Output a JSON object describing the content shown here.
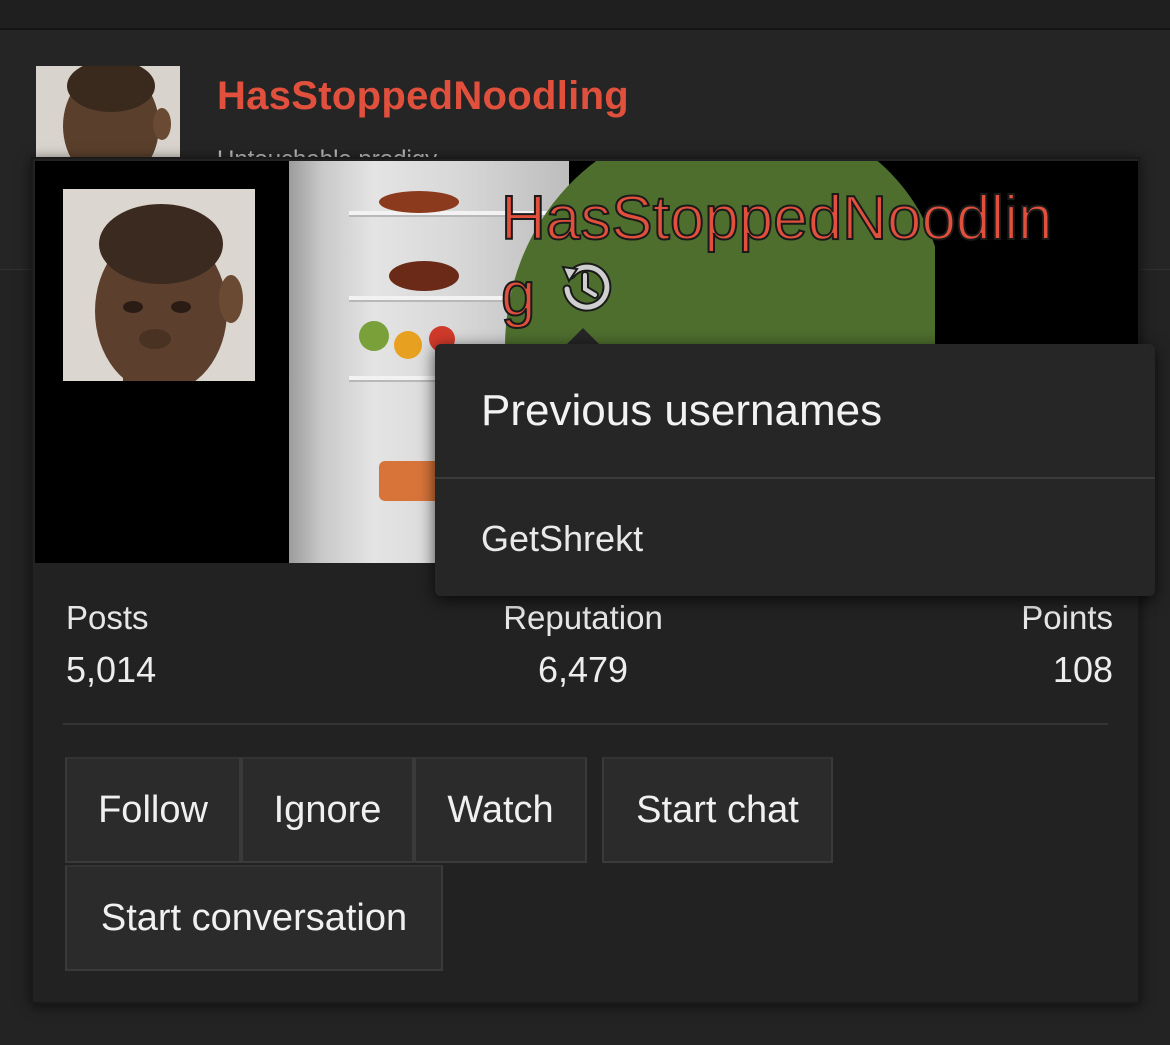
{
  "background_post": {
    "username": "HasStoppedNoodling",
    "subtitle": "Untouchable prodigy"
  },
  "card": {
    "username_line1": "HasStoppedNoodlin",
    "username_line2": "g",
    "stats": {
      "posts_label": "Posts",
      "posts_value": "5,014",
      "reputation_label": "Reputation",
      "reputation_value": "6,479",
      "points_label": "Points",
      "points_value": "108"
    },
    "buttons": {
      "follow": "Follow",
      "ignore": "Ignore",
      "watch": "Watch",
      "start_chat": "Start chat",
      "start_conversation": "Start conversation"
    }
  },
  "previous_usernames_menu": {
    "title": "Previous usernames",
    "items": [
      "GetShrekt"
    ]
  },
  "colors": {
    "username": "#e0503c",
    "background": "#232323",
    "button": "#2b2b2b"
  },
  "icons": {
    "history": "history-icon"
  }
}
